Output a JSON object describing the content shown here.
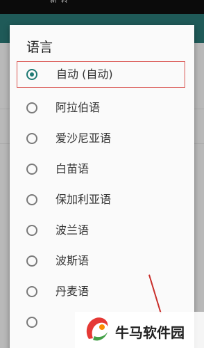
{
  "status_bar": {
    "text": "新ᶜ转ᶜᶜ"
  },
  "dialog": {
    "title": "语言",
    "options": [
      {
        "label": "自动 (自动)",
        "selected": true
      },
      {
        "label": "阿拉伯语",
        "selected": false
      },
      {
        "label": "爱沙尼亚语",
        "selected": false
      },
      {
        "label": "白苗语",
        "selected": false
      },
      {
        "label": "保加利亚语",
        "selected": false
      },
      {
        "label": "波兰语",
        "selected": false
      },
      {
        "label": "波斯语",
        "selected": false
      },
      {
        "label": "丹麦语",
        "selected": false
      }
    ]
  },
  "watermark": {
    "text": "牛马软件园"
  },
  "colors": {
    "app_bar": "#1f5a58",
    "radio_checked": "#1f7a74",
    "highlight_border": "#d9534f",
    "overlay_line": "#c9302c"
  }
}
